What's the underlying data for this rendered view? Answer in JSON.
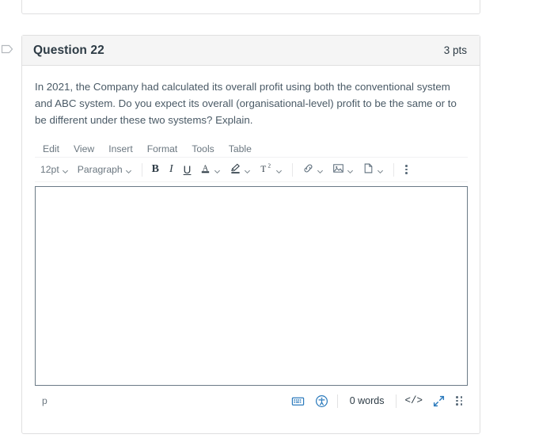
{
  "flag_icon": "bookmark-outline-icon",
  "question": {
    "title": "Question 22",
    "points": "3 pts",
    "text": "In 2021, the Company had calculated its overall profit using both the conventional system and ABC system. Do you expect its overall (organisational-level) profit to be the same or to be different under these two systems? Explain."
  },
  "editor": {
    "menubar": [
      {
        "label": "Edit"
      },
      {
        "label": "View"
      },
      {
        "label": "Insert"
      },
      {
        "label": "Format"
      },
      {
        "label": "Tools"
      },
      {
        "label": "Table"
      }
    ],
    "toolbar": {
      "font_size": "12pt",
      "block_format": "Paragraph",
      "bold": "B",
      "italic": "I",
      "underline": "U",
      "text_color": "A",
      "highlight": "highlighter-icon",
      "superscript": "T",
      "superscript_exp": "2",
      "link": "link-icon",
      "image": "image-icon",
      "document": "document-icon",
      "more": "kebab-menu-icon"
    },
    "content": "",
    "status": {
      "element_path": "p",
      "keyboard_shortcuts": "keyboard-icon",
      "accessibility_checker": "accessibility-icon",
      "word_count": "0 words",
      "html_editor": "</>",
      "fullscreen": "expand-arrows-icon",
      "resize_handle": "resize-grip-icon"
    }
  },
  "colors": {
    "accent": "#2b7abc",
    "card_border": "#dfdfe0",
    "header_bg": "#f5f5f5",
    "heading": "#2d3b45",
    "body_text": "#4a5a66",
    "muted": "#6b7780",
    "editor_border": "#6b7a86"
  }
}
